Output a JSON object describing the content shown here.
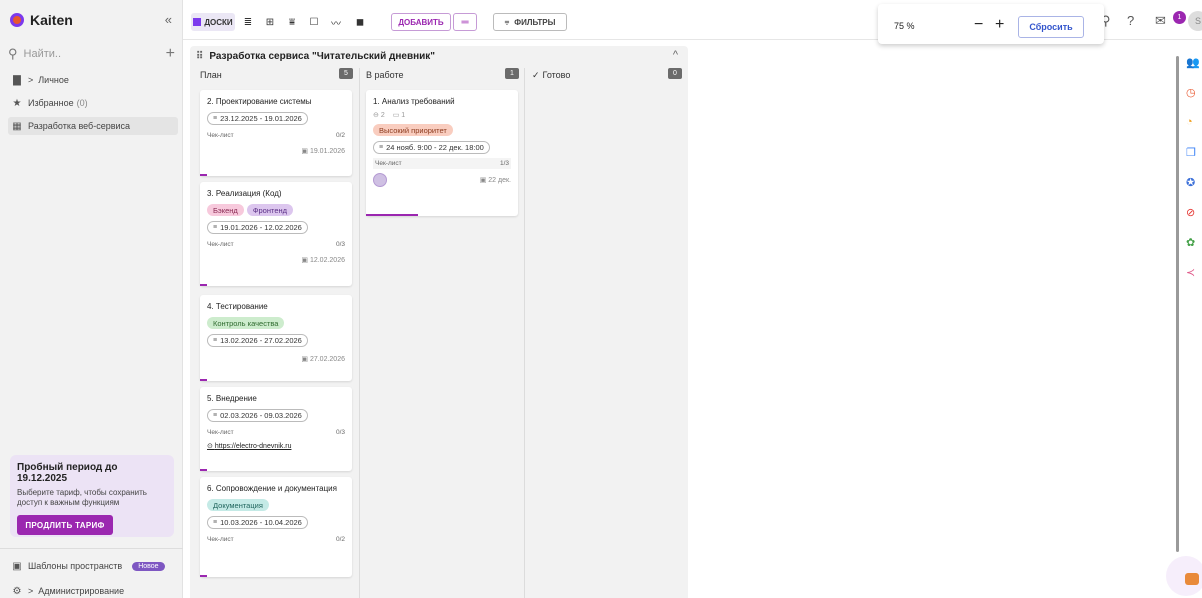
{
  "app": {
    "name": "Kaiten"
  },
  "sidebar": {
    "search_placeholder": "Найти..",
    "items": [
      {
        "label": "Личное",
        "prefix": ">"
      },
      {
        "label": "Избранное",
        "count": "(0)"
      },
      {
        "label": "Разработка веб-сервиса"
      }
    ],
    "promo": {
      "title": "Пробный период до 19.12.2025",
      "text": "Выберите тариф, чтобы сохранить доступ к важным функциям",
      "button": "ПРОДЛИТЬ ТАРИФ"
    },
    "templates_label": "Шаблоны пространств",
    "new_badge": "Новое",
    "admin_label": "Администрирование"
  },
  "toolbar": {
    "boards_label": "ДОСКИ",
    "add_label": "ДОБАВИТЬ",
    "filters_label": "ФИЛЬТРЫ",
    "zoom_value": "75 %",
    "reset_label": "Сбросить",
    "notifications_count": "1",
    "avatar_initial": "S"
  },
  "board": {
    "title": "Разработка сервиса \"Читательский дневник\"",
    "columns": [
      {
        "name": "План",
        "count": "5",
        "cards": [
          {
            "title": "2. Проектирование системы",
            "dates": "23.12.2025 - 19.01.2026",
            "checklist_label": "Чек-лист",
            "checklist": "0/2",
            "due": "19.01.2026"
          },
          {
            "title": "3. Реализация (Код)",
            "tags": [
              "Бэкенд",
              "Фронтенд"
            ],
            "dates": "19.01.2026 - 12.02.2026",
            "checklist_label": "Чек-лист",
            "checklist": "0/3",
            "due": "12.02.2026"
          },
          {
            "title": "4. Тестирование",
            "tags": [
              "Контроль качества"
            ],
            "dates": "13.02.2026 - 27.02.2026",
            "due": "27.02.2026"
          },
          {
            "title": "5. Внедрение",
            "dates": "02.03.2026 - 09.03.2026",
            "checklist_label": "Чек-лист",
            "checklist": "0/3",
            "link": "https://electro-dnevnik.ru"
          },
          {
            "title": "6. Сопровождение и документация",
            "tags": [
              "Документация"
            ],
            "dates": "10.03.2026 - 10.04.2026",
            "checklist_label": "Чек-лист",
            "checklist": "0/2"
          }
        ]
      },
      {
        "name": "В работе",
        "count": "1",
        "cards": [
          {
            "title": "1. Анализ требований",
            "meta_links": "2",
            "meta_comments": "1",
            "tags": [
              "Высокий приоритет"
            ],
            "dates": "24 нояб. 9:00 - 22 дек. 18:00",
            "checklist_label": "Чек-лист",
            "checklist": "1/3",
            "due": "22 дек."
          }
        ]
      },
      {
        "name": "Готово",
        "count": "0",
        "cards": []
      }
    ]
  },
  "colors": {
    "accent": "#9b27b0",
    "tag_backend": "#f7c9dc",
    "tag_frontend": "#dcc6ee",
    "tag_qa": "#cdeccd",
    "tag_docs": "#c4eae6",
    "tag_priority": "#f9cdbf"
  }
}
